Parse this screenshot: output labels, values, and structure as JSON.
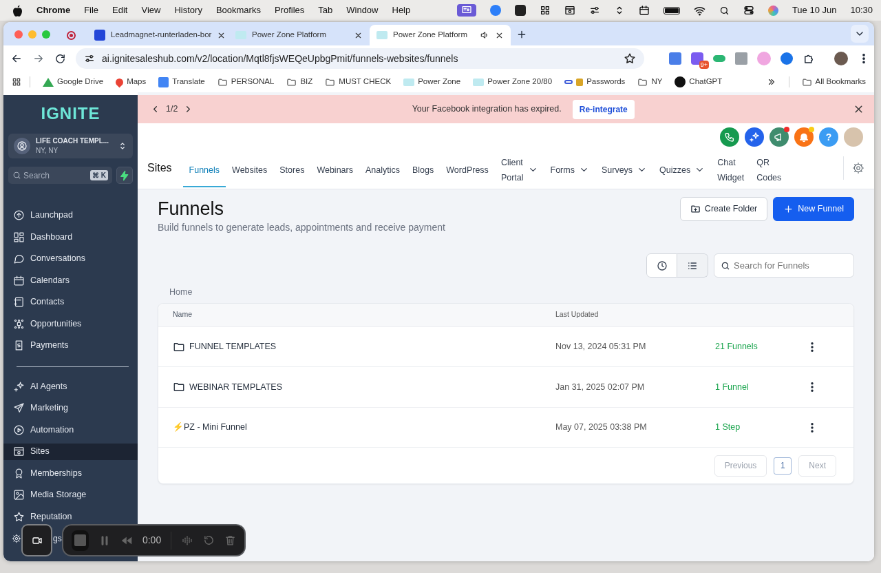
{
  "menubar": {
    "app": "Chrome",
    "menus": [
      "File",
      "Edit",
      "View",
      "History",
      "Bookmarks",
      "Profiles",
      "Tab",
      "Window",
      "Help"
    ],
    "date": "Tue 10 Jun",
    "time": "10:30"
  },
  "browser": {
    "tabs": [
      {
        "title": "Leadmagnet-runterladen-bor",
        "selected": false,
        "audio": false
      },
      {
        "title": "Power Zone Platform",
        "selected": false,
        "audio": false
      },
      {
        "title": "Power Zone Platform",
        "selected": true,
        "audio": true
      }
    ],
    "url": "ai.ignitesaleshub.com/v2/location/Mqtl8fjsWEQeUpbgPmit/funnels-websites/funnels",
    "extension_badge": "9+",
    "bookmarks": [
      {
        "label": "Google Drive",
        "kind": "drive"
      },
      {
        "label": "Maps",
        "kind": "maps"
      },
      {
        "label": "Translate",
        "kind": "translate"
      },
      {
        "label": "PERSONAL",
        "kind": "folder"
      },
      {
        "label": "BIZ",
        "kind": "folder"
      },
      {
        "label": "MUST CHECK",
        "kind": "folder"
      },
      {
        "label": "Power Zone",
        "kind": "site"
      },
      {
        "label": "Power Zone 20/80",
        "kind": "site"
      },
      {
        "label": "Passwords",
        "kind": "key"
      },
      {
        "label": "NY",
        "kind": "folder"
      },
      {
        "label": "ChatGPT",
        "kind": "chatgpt"
      }
    ],
    "all_bookmarks": "All Bookmarks"
  },
  "sidebar": {
    "logo": "IGNITE",
    "account": {
      "name": "LIFE COACH TEMPL...",
      "location": "NY, NY"
    },
    "search": {
      "placeholder": "Search",
      "shortcut": "⌘ K"
    },
    "groups": [
      {
        "items": [
          {
            "label": "Launchpad",
            "selected": false
          },
          {
            "label": "Dashboard",
            "selected": false
          },
          {
            "label": "Conversations",
            "selected": false
          },
          {
            "label": "Calendars",
            "selected": false
          },
          {
            "label": "Contacts",
            "selected": false
          },
          {
            "label": "Opportunities",
            "selected": false
          },
          {
            "label": "Payments",
            "selected": false
          }
        ]
      },
      {
        "items": [
          {
            "label": "AI Agents",
            "selected": false
          },
          {
            "label": "Marketing",
            "selected": false
          },
          {
            "label": "Automation",
            "selected": false
          },
          {
            "label": "Sites",
            "selected": true
          },
          {
            "label": "Memberships",
            "selected": false
          },
          {
            "label": "Media Storage",
            "selected": false
          },
          {
            "label": "Reputation",
            "selected": false
          },
          {
            "label": "gs",
            "selected": false
          }
        ]
      }
    ]
  },
  "banner": {
    "pager": "1/2",
    "message": "Your Facebook integration has expired.",
    "action": "Re-integrate"
  },
  "header": {
    "help": "?"
  },
  "nav": {
    "section": "Sites",
    "tabs": [
      {
        "label": "Funnels",
        "selected": true,
        "dropdown": false
      },
      {
        "label": "Websites",
        "selected": false,
        "dropdown": false
      },
      {
        "label": "Stores",
        "selected": false,
        "dropdown": false
      },
      {
        "label": "Webinars",
        "selected": false,
        "dropdown": false
      },
      {
        "label": "Analytics",
        "selected": false,
        "dropdown": false
      },
      {
        "label": "Blogs",
        "selected": false,
        "dropdown": false
      },
      {
        "label": "WordPress",
        "selected": false,
        "dropdown": false
      },
      {
        "label": "Client Portal",
        "selected": false,
        "dropdown": true
      },
      {
        "label": "Forms",
        "selected": false,
        "dropdown": true
      },
      {
        "label": "Surveys",
        "selected": false,
        "dropdown": true
      },
      {
        "label": "Quizzes",
        "selected": false,
        "dropdown": true
      },
      {
        "label": "Chat Widget",
        "selected": false,
        "dropdown": false
      },
      {
        "label": "QR Codes",
        "selected": false,
        "dropdown": false
      }
    ]
  },
  "page": {
    "title": "Funnels",
    "subtitle": "Build funnels to generate leads, appointments and receive payment",
    "create_folder": "Create Folder",
    "new_funnel": "New Funnel",
    "views": [
      {
        "kind": "recent",
        "selected": false
      },
      {
        "kind": "list",
        "selected": true
      }
    ],
    "search": {
      "placeholder": "Search for Funnels"
    },
    "breadcrumb": "Home"
  },
  "table": {
    "columns": [
      "Name",
      "Last Updated"
    ],
    "rows": [
      {
        "kind": "folder",
        "name": "FUNNEL TEMPLATES",
        "updated": "Nov 13, 2024 05:31 PM",
        "count": "21 Funnels"
      },
      {
        "kind": "folder",
        "name": "WEBINAR TEMPLATES",
        "updated": "Jan 31, 2025 02:07 PM",
        "count": "1 Funnel"
      },
      {
        "kind": "funnel",
        "name": "⚡PZ - Mini Funnel",
        "updated": "May 07, 2025 03:38 PM",
        "count": "1 Step"
      }
    ],
    "pagination": {
      "previous": "Previous",
      "pages": [
        {
          "label": "1",
          "selected": true
        }
      ],
      "next": "Next"
    }
  },
  "recorder": {
    "time": "0:00"
  }
}
